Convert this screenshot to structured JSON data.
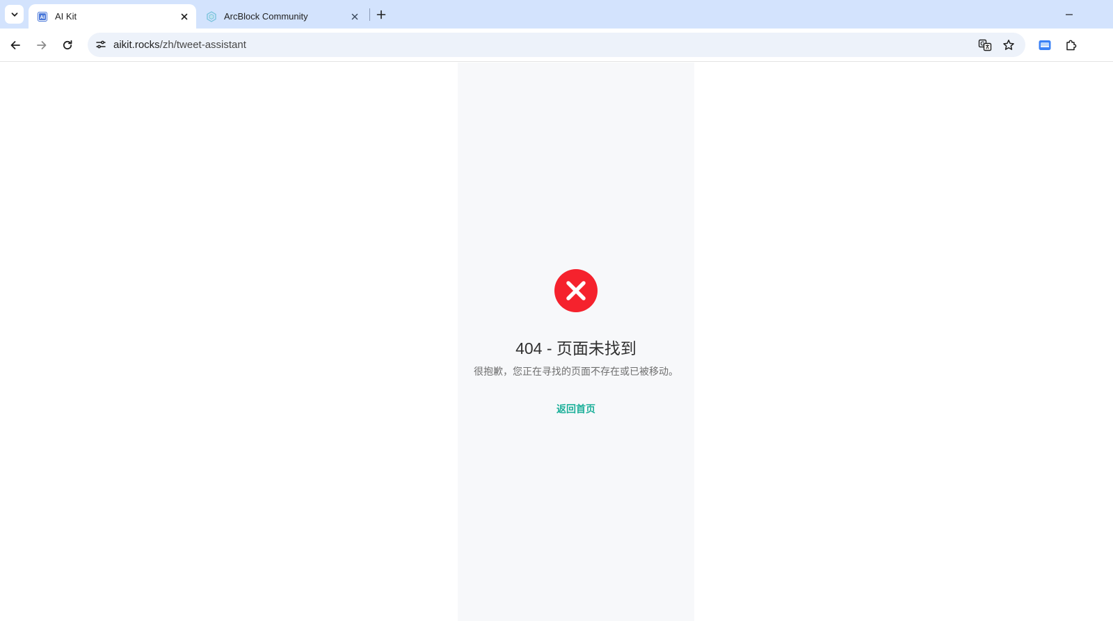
{
  "browser": {
    "tabs": [
      {
        "title": "AI Kit",
        "active": true,
        "favicon": "ai-kit-favicon"
      },
      {
        "title": "ArcBlock Community",
        "active": false,
        "favicon": "arcblock-favicon"
      }
    ],
    "address": {
      "host": "aikit.rocks",
      "path": "/zh/tweet-assistant"
    }
  },
  "page": {
    "error_title": "404 - 页面未找到",
    "error_description": "很抱歉，您正在寻找的页面不存在或已被移动。",
    "home_link": "返回首页"
  },
  "colors": {
    "error_red": "#f5222d",
    "link_teal": "#1eb09a",
    "panel_bg": "#f7f8fa",
    "tabstrip_bg": "#d3e3fd"
  }
}
